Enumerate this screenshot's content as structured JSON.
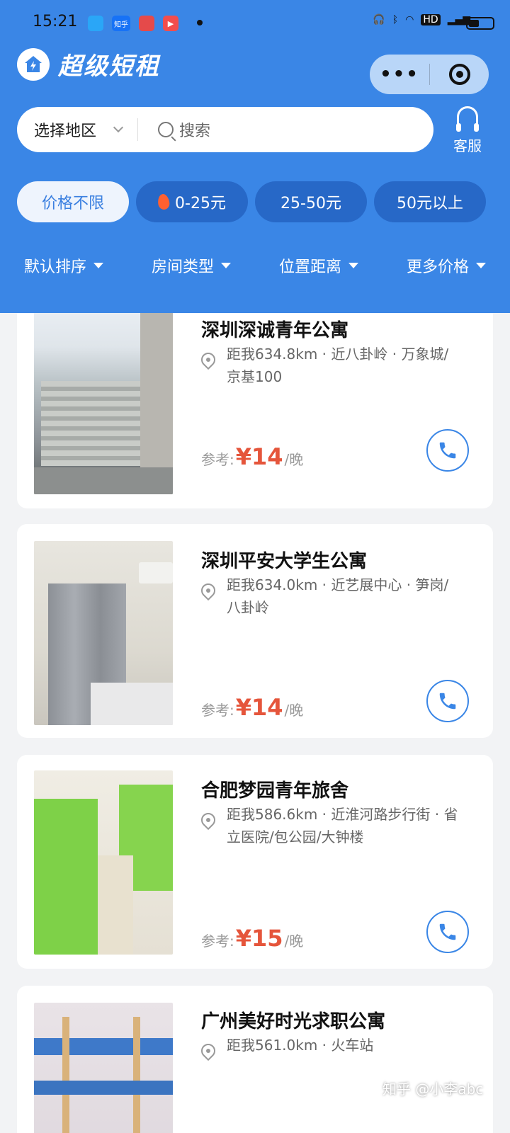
{
  "status_bar": {
    "time": "15:21",
    "app_icons": [
      "qq-icon",
      "zhihu-icon",
      "app-icon",
      "video-icon"
    ],
    "zhihu_text": "知乎"
  },
  "header": {
    "logo_text": "超级短租",
    "region_label": "选择地区",
    "search_placeholder": "搜索",
    "service_label": "客服",
    "accent": "#3a86e6"
  },
  "price_chips": [
    {
      "label": "价格不限",
      "active": true
    },
    {
      "label": "0-25元",
      "hot": true
    },
    {
      "label": "25-50元"
    },
    {
      "label": "50元以上"
    }
  ],
  "sort_bar": [
    "默认排序",
    "房间类型",
    "位置距离",
    "更多价格"
  ],
  "listings": [
    {
      "title": "深圳深诚青年公寓",
      "address": "距我634.8km · 近八卦岭 · 万象城/京基100",
      "price_prefix": "参考:",
      "price": "¥14",
      "unit": "/晚"
    },
    {
      "title": "深圳平安大学生公寓",
      "address": "距我634.0km · 近艺展中心 · 笋岗/八卦岭",
      "price_prefix": "参考:",
      "price": "¥14",
      "unit": "/晚"
    },
    {
      "title": "合肥梦园青年旅舍",
      "address": "距我586.6km · 近淮河路步行街 · 省立医院/包公园/大钟楼",
      "price_prefix": "参考:",
      "price": "¥15",
      "unit": "/晚"
    },
    {
      "title": "广州美好时光求职公寓",
      "address": "距我561.0km · 火车站"
    }
  ],
  "watermark": "知乎 @小李abc"
}
